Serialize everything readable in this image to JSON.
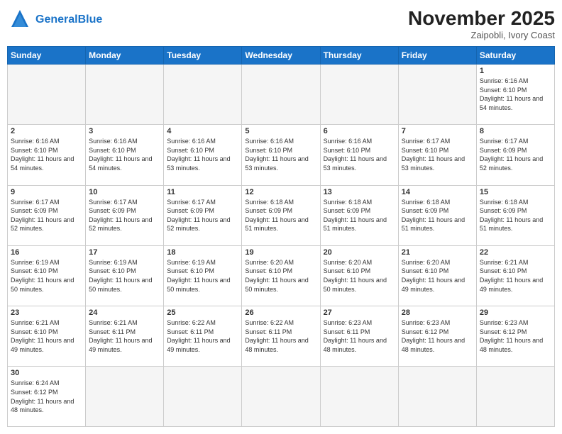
{
  "header": {
    "logo_general": "General",
    "logo_blue": "Blue",
    "month_title": "November 2025",
    "location": "Zaipobli, Ivory Coast"
  },
  "days_of_week": [
    "Sunday",
    "Monday",
    "Tuesday",
    "Wednesday",
    "Thursday",
    "Friday",
    "Saturday"
  ],
  "weeks": [
    [
      {
        "day": "",
        "empty": true
      },
      {
        "day": "",
        "empty": true
      },
      {
        "day": "",
        "empty": true
      },
      {
        "day": "",
        "empty": true
      },
      {
        "day": "",
        "empty": true
      },
      {
        "day": "",
        "empty": true
      },
      {
        "day": "1",
        "sunrise": "6:16 AM",
        "sunset": "6:10 PM",
        "daylight": "11 hours and 54 minutes."
      }
    ],
    [
      {
        "day": "2",
        "sunrise": "6:16 AM",
        "sunset": "6:10 PM",
        "daylight": "11 hours and 54 minutes."
      },
      {
        "day": "3",
        "sunrise": "6:16 AM",
        "sunset": "6:10 PM",
        "daylight": "11 hours and 54 minutes."
      },
      {
        "day": "4",
        "sunrise": "6:16 AM",
        "sunset": "6:10 PM",
        "daylight": "11 hours and 53 minutes."
      },
      {
        "day": "5",
        "sunrise": "6:16 AM",
        "sunset": "6:10 PM",
        "daylight": "11 hours and 53 minutes."
      },
      {
        "day": "6",
        "sunrise": "6:16 AM",
        "sunset": "6:10 PM",
        "daylight": "11 hours and 53 minutes."
      },
      {
        "day": "7",
        "sunrise": "6:17 AM",
        "sunset": "6:10 PM",
        "daylight": "11 hours and 53 minutes."
      },
      {
        "day": "8",
        "sunrise": "6:17 AM",
        "sunset": "6:09 PM",
        "daylight": "11 hours and 52 minutes."
      }
    ],
    [
      {
        "day": "9",
        "sunrise": "6:17 AM",
        "sunset": "6:09 PM",
        "daylight": "11 hours and 52 minutes."
      },
      {
        "day": "10",
        "sunrise": "6:17 AM",
        "sunset": "6:09 PM",
        "daylight": "11 hours and 52 minutes."
      },
      {
        "day": "11",
        "sunrise": "6:17 AM",
        "sunset": "6:09 PM",
        "daylight": "11 hours and 52 minutes."
      },
      {
        "day": "12",
        "sunrise": "6:18 AM",
        "sunset": "6:09 PM",
        "daylight": "11 hours and 51 minutes."
      },
      {
        "day": "13",
        "sunrise": "6:18 AM",
        "sunset": "6:09 PM",
        "daylight": "11 hours and 51 minutes."
      },
      {
        "day": "14",
        "sunrise": "6:18 AM",
        "sunset": "6:09 PM",
        "daylight": "11 hours and 51 minutes."
      },
      {
        "day": "15",
        "sunrise": "6:18 AM",
        "sunset": "6:09 PM",
        "daylight": "11 hours and 51 minutes."
      }
    ],
    [
      {
        "day": "16",
        "sunrise": "6:19 AM",
        "sunset": "6:10 PM",
        "daylight": "11 hours and 50 minutes."
      },
      {
        "day": "17",
        "sunrise": "6:19 AM",
        "sunset": "6:10 PM",
        "daylight": "11 hours and 50 minutes."
      },
      {
        "day": "18",
        "sunrise": "6:19 AM",
        "sunset": "6:10 PM",
        "daylight": "11 hours and 50 minutes."
      },
      {
        "day": "19",
        "sunrise": "6:20 AM",
        "sunset": "6:10 PM",
        "daylight": "11 hours and 50 minutes."
      },
      {
        "day": "20",
        "sunrise": "6:20 AM",
        "sunset": "6:10 PM",
        "daylight": "11 hours and 50 minutes."
      },
      {
        "day": "21",
        "sunrise": "6:20 AM",
        "sunset": "6:10 PM",
        "daylight": "11 hours and 49 minutes."
      },
      {
        "day": "22",
        "sunrise": "6:21 AM",
        "sunset": "6:10 PM",
        "daylight": "11 hours and 49 minutes."
      }
    ],
    [
      {
        "day": "23",
        "sunrise": "6:21 AM",
        "sunset": "6:10 PM",
        "daylight": "11 hours and 49 minutes."
      },
      {
        "day": "24",
        "sunrise": "6:21 AM",
        "sunset": "6:11 PM",
        "daylight": "11 hours and 49 minutes."
      },
      {
        "day": "25",
        "sunrise": "6:22 AM",
        "sunset": "6:11 PM",
        "daylight": "11 hours and 49 minutes."
      },
      {
        "day": "26",
        "sunrise": "6:22 AM",
        "sunset": "6:11 PM",
        "daylight": "11 hours and 48 minutes."
      },
      {
        "day": "27",
        "sunrise": "6:23 AM",
        "sunset": "6:11 PM",
        "daylight": "11 hours and 48 minutes."
      },
      {
        "day": "28",
        "sunrise": "6:23 AM",
        "sunset": "6:12 PM",
        "daylight": "11 hours and 48 minutes."
      },
      {
        "day": "29",
        "sunrise": "6:23 AM",
        "sunset": "6:12 PM",
        "daylight": "11 hours and 48 minutes."
      }
    ],
    [
      {
        "day": "30",
        "sunrise": "6:24 AM",
        "sunset": "6:12 PM",
        "daylight": "11 hours and 48 minutes.",
        "last": true
      },
      {
        "day": "",
        "empty": true,
        "last": true
      },
      {
        "day": "",
        "empty": true,
        "last": true
      },
      {
        "day": "",
        "empty": true,
        "last": true
      },
      {
        "day": "",
        "empty": true,
        "last": true
      },
      {
        "day": "",
        "empty": true,
        "last": true
      },
      {
        "day": "",
        "empty": true,
        "last": true
      }
    ]
  ]
}
